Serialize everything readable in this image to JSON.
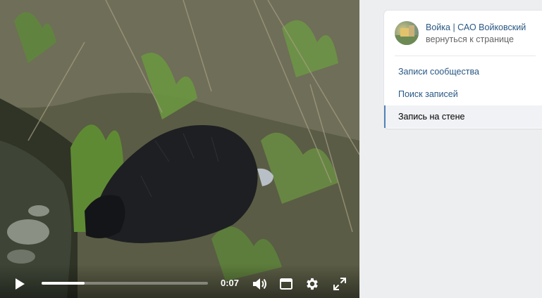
{
  "video": {
    "current_time": "0:07",
    "progress": 0.26,
    "controls": {
      "play_icon": "play-icon",
      "volume_icon": "volume-icon",
      "miniplayer_icon": "miniplayer-icon",
      "settings_icon": "gear-icon",
      "fullscreen_icon": "fullscreen-icon"
    }
  },
  "sidebar": {
    "group_name": "Войка | САО Войковский",
    "back_label": "вернуться к странице",
    "items": [
      {
        "label": "Записи сообщества",
        "active": false
      },
      {
        "label": "Поиск записей",
        "active": false
      },
      {
        "label": "Запись на стене",
        "active": true
      }
    ]
  },
  "colors": {
    "link": "#2a5885",
    "active_bar": "#5181b8",
    "page_bg": "#edeef0"
  }
}
